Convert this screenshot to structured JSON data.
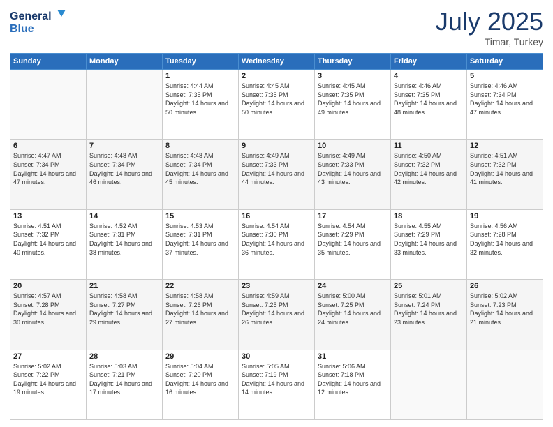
{
  "header": {
    "logo_line1": "General",
    "logo_line2": "Blue",
    "month_year": "July 2025",
    "location": "Timar, Turkey"
  },
  "days_of_week": [
    "Sunday",
    "Monday",
    "Tuesday",
    "Wednesday",
    "Thursday",
    "Friday",
    "Saturday"
  ],
  "weeks": [
    [
      {
        "day": "",
        "sunrise": "",
        "sunset": "",
        "daylight": ""
      },
      {
        "day": "",
        "sunrise": "",
        "sunset": "",
        "daylight": ""
      },
      {
        "day": "1",
        "sunrise": "Sunrise: 4:44 AM",
        "sunset": "Sunset: 7:35 PM",
        "daylight": "Daylight: 14 hours and 50 minutes."
      },
      {
        "day": "2",
        "sunrise": "Sunrise: 4:45 AM",
        "sunset": "Sunset: 7:35 PM",
        "daylight": "Daylight: 14 hours and 50 minutes."
      },
      {
        "day": "3",
        "sunrise": "Sunrise: 4:45 AM",
        "sunset": "Sunset: 7:35 PM",
        "daylight": "Daylight: 14 hours and 49 minutes."
      },
      {
        "day": "4",
        "sunrise": "Sunrise: 4:46 AM",
        "sunset": "Sunset: 7:35 PM",
        "daylight": "Daylight: 14 hours and 48 minutes."
      },
      {
        "day": "5",
        "sunrise": "Sunrise: 4:46 AM",
        "sunset": "Sunset: 7:34 PM",
        "daylight": "Daylight: 14 hours and 47 minutes."
      }
    ],
    [
      {
        "day": "6",
        "sunrise": "Sunrise: 4:47 AM",
        "sunset": "Sunset: 7:34 PM",
        "daylight": "Daylight: 14 hours and 47 minutes."
      },
      {
        "day": "7",
        "sunrise": "Sunrise: 4:48 AM",
        "sunset": "Sunset: 7:34 PM",
        "daylight": "Daylight: 14 hours and 46 minutes."
      },
      {
        "day": "8",
        "sunrise": "Sunrise: 4:48 AM",
        "sunset": "Sunset: 7:34 PM",
        "daylight": "Daylight: 14 hours and 45 minutes."
      },
      {
        "day": "9",
        "sunrise": "Sunrise: 4:49 AM",
        "sunset": "Sunset: 7:33 PM",
        "daylight": "Daylight: 14 hours and 44 minutes."
      },
      {
        "day": "10",
        "sunrise": "Sunrise: 4:49 AM",
        "sunset": "Sunset: 7:33 PM",
        "daylight": "Daylight: 14 hours and 43 minutes."
      },
      {
        "day": "11",
        "sunrise": "Sunrise: 4:50 AM",
        "sunset": "Sunset: 7:32 PM",
        "daylight": "Daylight: 14 hours and 42 minutes."
      },
      {
        "day": "12",
        "sunrise": "Sunrise: 4:51 AM",
        "sunset": "Sunset: 7:32 PM",
        "daylight": "Daylight: 14 hours and 41 minutes."
      }
    ],
    [
      {
        "day": "13",
        "sunrise": "Sunrise: 4:51 AM",
        "sunset": "Sunset: 7:32 PM",
        "daylight": "Daylight: 14 hours and 40 minutes."
      },
      {
        "day": "14",
        "sunrise": "Sunrise: 4:52 AM",
        "sunset": "Sunset: 7:31 PM",
        "daylight": "Daylight: 14 hours and 38 minutes."
      },
      {
        "day": "15",
        "sunrise": "Sunrise: 4:53 AM",
        "sunset": "Sunset: 7:31 PM",
        "daylight": "Daylight: 14 hours and 37 minutes."
      },
      {
        "day": "16",
        "sunrise": "Sunrise: 4:54 AM",
        "sunset": "Sunset: 7:30 PM",
        "daylight": "Daylight: 14 hours and 36 minutes."
      },
      {
        "day": "17",
        "sunrise": "Sunrise: 4:54 AM",
        "sunset": "Sunset: 7:29 PM",
        "daylight": "Daylight: 14 hours and 35 minutes."
      },
      {
        "day": "18",
        "sunrise": "Sunrise: 4:55 AM",
        "sunset": "Sunset: 7:29 PM",
        "daylight": "Daylight: 14 hours and 33 minutes."
      },
      {
        "day": "19",
        "sunrise": "Sunrise: 4:56 AM",
        "sunset": "Sunset: 7:28 PM",
        "daylight": "Daylight: 14 hours and 32 minutes."
      }
    ],
    [
      {
        "day": "20",
        "sunrise": "Sunrise: 4:57 AM",
        "sunset": "Sunset: 7:28 PM",
        "daylight": "Daylight: 14 hours and 30 minutes."
      },
      {
        "day": "21",
        "sunrise": "Sunrise: 4:58 AM",
        "sunset": "Sunset: 7:27 PM",
        "daylight": "Daylight: 14 hours and 29 minutes."
      },
      {
        "day": "22",
        "sunrise": "Sunrise: 4:58 AM",
        "sunset": "Sunset: 7:26 PM",
        "daylight": "Daylight: 14 hours and 27 minutes."
      },
      {
        "day": "23",
        "sunrise": "Sunrise: 4:59 AM",
        "sunset": "Sunset: 7:25 PM",
        "daylight": "Daylight: 14 hours and 26 minutes."
      },
      {
        "day": "24",
        "sunrise": "Sunrise: 5:00 AM",
        "sunset": "Sunset: 7:25 PM",
        "daylight": "Daylight: 14 hours and 24 minutes."
      },
      {
        "day": "25",
        "sunrise": "Sunrise: 5:01 AM",
        "sunset": "Sunset: 7:24 PM",
        "daylight": "Daylight: 14 hours and 23 minutes."
      },
      {
        "day": "26",
        "sunrise": "Sunrise: 5:02 AM",
        "sunset": "Sunset: 7:23 PM",
        "daylight": "Daylight: 14 hours and 21 minutes."
      }
    ],
    [
      {
        "day": "27",
        "sunrise": "Sunrise: 5:02 AM",
        "sunset": "Sunset: 7:22 PM",
        "daylight": "Daylight: 14 hours and 19 minutes."
      },
      {
        "day": "28",
        "sunrise": "Sunrise: 5:03 AM",
        "sunset": "Sunset: 7:21 PM",
        "daylight": "Daylight: 14 hours and 17 minutes."
      },
      {
        "day": "29",
        "sunrise": "Sunrise: 5:04 AM",
        "sunset": "Sunset: 7:20 PM",
        "daylight": "Daylight: 14 hours and 16 minutes."
      },
      {
        "day": "30",
        "sunrise": "Sunrise: 5:05 AM",
        "sunset": "Sunset: 7:19 PM",
        "daylight": "Daylight: 14 hours and 14 minutes."
      },
      {
        "day": "31",
        "sunrise": "Sunrise: 5:06 AM",
        "sunset": "Sunset: 7:18 PM",
        "daylight": "Daylight: 14 hours and 12 minutes."
      },
      {
        "day": "",
        "sunrise": "",
        "sunset": "",
        "daylight": ""
      },
      {
        "day": "",
        "sunrise": "",
        "sunset": "",
        "daylight": ""
      }
    ]
  ]
}
